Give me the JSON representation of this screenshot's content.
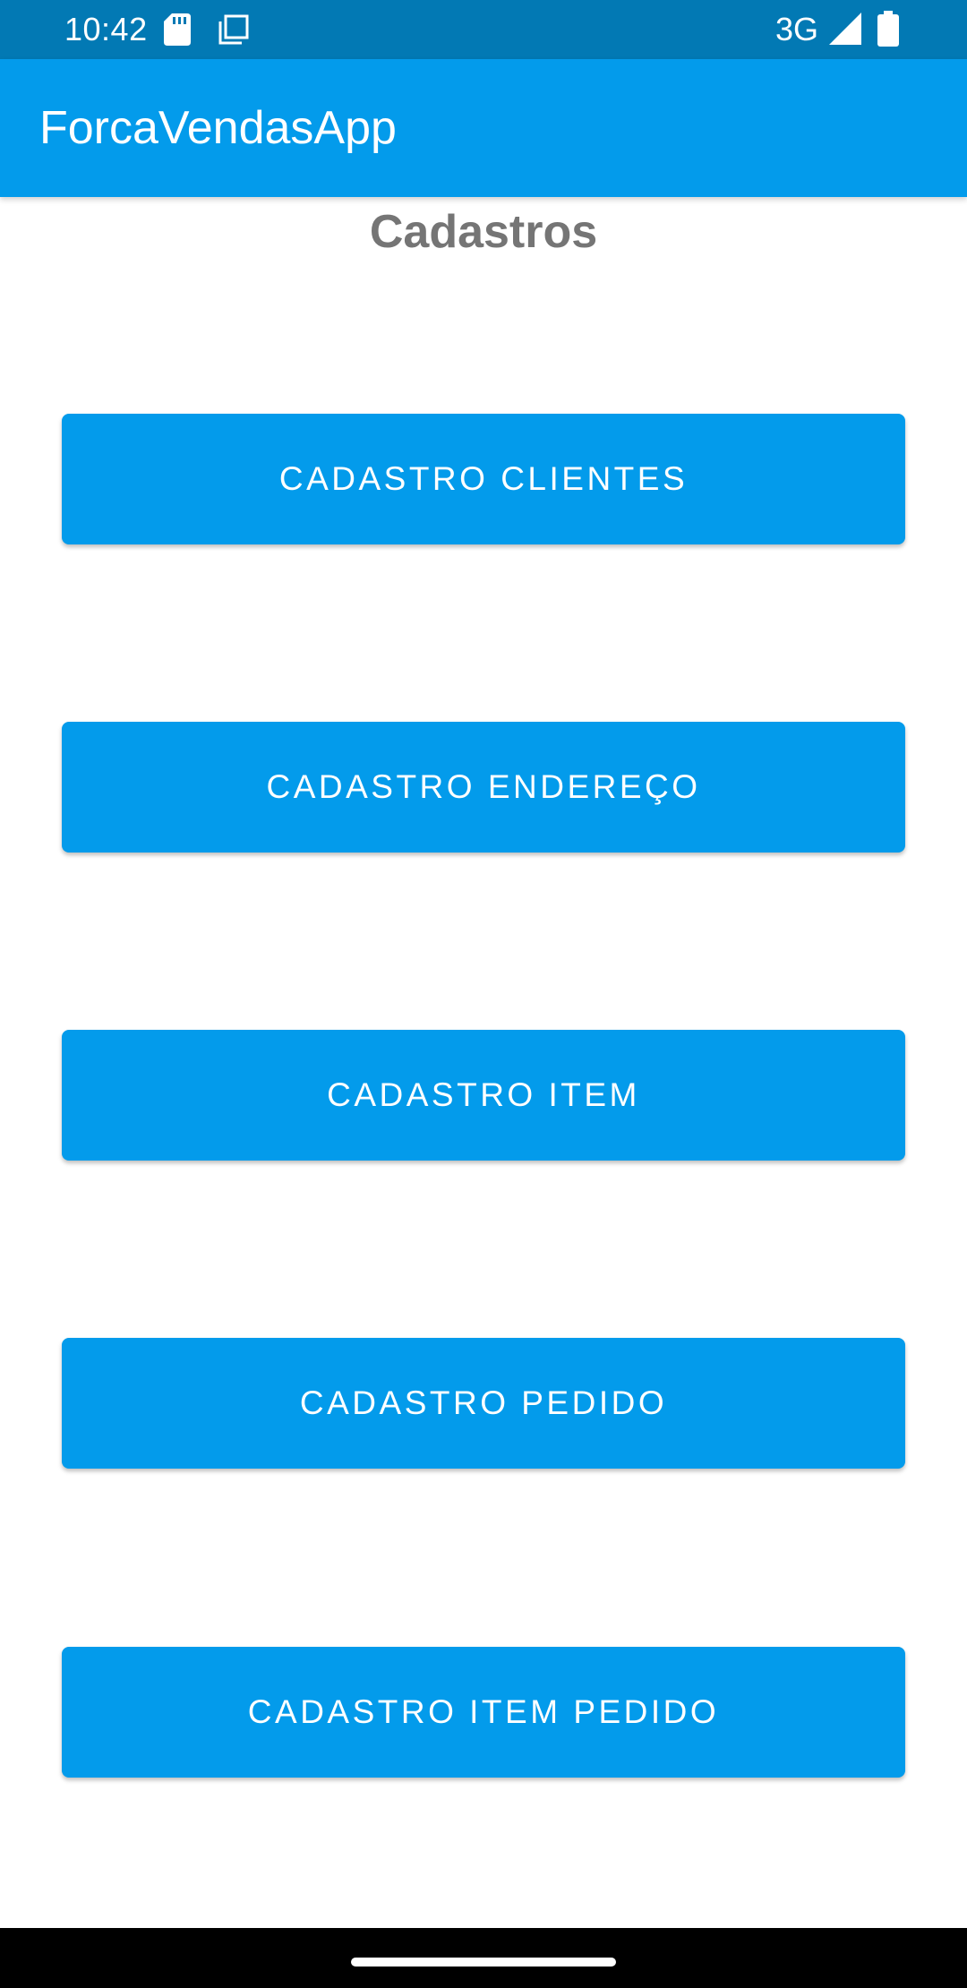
{
  "status_bar": {
    "time": "10:42",
    "icons": [
      "sd-card-icon",
      "copy-icon"
    ],
    "network": "3G",
    "signal_icon": "signal-icon",
    "battery_icon": "battery-icon"
  },
  "app_bar": {
    "title": "ForcaVendasApp"
  },
  "page": {
    "heading": "Cadastros"
  },
  "buttons": [
    {
      "label": "CADASTRO CLIENTES"
    },
    {
      "label": "CADASTRO ENDEREÇO"
    },
    {
      "label": "CADASTRO ITEM"
    },
    {
      "label": "CADASTRO PEDIDO"
    },
    {
      "label": "CADASTRO ITEM PEDIDO"
    }
  ],
  "colors": {
    "status_bar": "#0279B4",
    "primary": "#039BEB",
    "heading_text": "#757575",
    "nav_bar": "#000000"
  },
  "nav_bar": {
    "home_indicator": "home-pill"
  }
}
